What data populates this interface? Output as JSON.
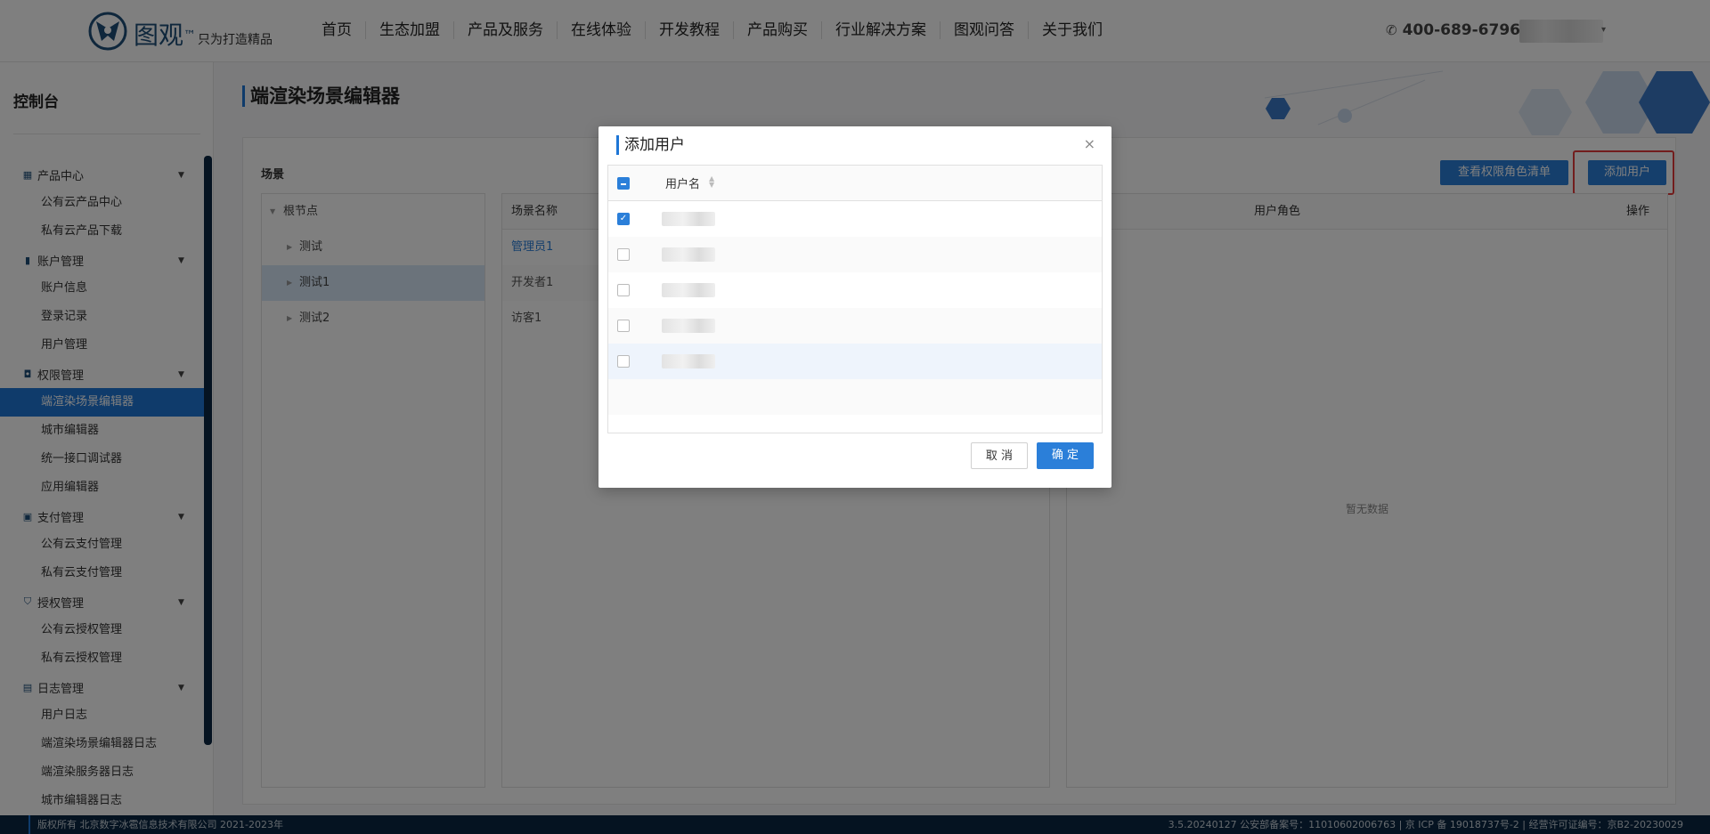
{
  "header": {
    "logo_name": "图观",
    "logo_tm": "™",
    "logo_slogan": "只为打造精品",
    "nav": [
      "首页",
      "生态加盟",
      "产品及服务",
      "在线体验",
      "开发教程",
      "产品购买",
      "行业解决方案",
      "图观问答",
      "关于我们"
    ],
    "phone": "400-689-6796",
    "phone_icon": "phone-icon",
    "user_caret": "▾"
  },
  "sidebar": {
    "title": "控制台",
    "groups": [
      {
        "label": "产品中心",
        "icon": "grid-icon",
        "items": [
          "公有云产品中心",
          "私有云产品下载"
        ]
      },
      {
        "label": "账户管理",
        "icon": "bookmark-icon",
        "items": [
          "账户信息",
          "登录记录",
          "用户管理"
        ]
      },
      {
        "label": "权限管理",
        "icon": "lock-icon",
        "items": [
          "端渲染场景编辑器",
          "城市编辑器",
          "统一接口调试器",
          "应用编辑器"
        ]
      },
      {
        "label": "支付管理",
        "icon": "ticket-icon",
        "items": [
          "公有云支付管理",
          "私有云支付管理"
        ]
      },
      {
        "label": "授权管理",
        "icon": "shield-icon",
        "items": [
          "公有云授权管理",
          "私有云授权管理"
        ]
      },
      {
        "label": "日志管理",
        "icon": "log-icon",
        "items": [
          "用户日志",
          "端渲染场景编辑器日志",
          "端渲染服务器日志",
          "城市编辑器日志"
        ]
      }
    ],
    "active_item": "端渲染场景编辑器"
  },
  "main": {
    "title": "端渲染场景编辑器",
    "scene_label": "场景",
    "btn_roles": "查看权限角色清单",
    "btn_add_user": "添加用户",
    "tree": {
      "root": "根节点",
      "children": [
        "测试",
        "测试1",
        "测试2"
      ],
      "selected": "测试1"
    },
    "scene_table": {
      "header": "场景名称",
      "rows": [
        "管理员1",
        "开发者1",
        "访客1"
      ]
    },
    "user_table": {
      "col_role": "用户角色",
      "col_action": "操作",
      "empty": "暂无数据"
    }
  },
  "modal": {
    "title": "添加用户",
    "close": "×",
    "col_username": "用户名",
    "rows": [
      {
        "checked": true
      },
      {
        "checked": false
      },
      {
        "checked": false
      },
      {
        "checked": false
      },
      {
        "checked": false
      }
    ],
    "cancel": "取 消",
    "ok": "确 定"
  },
  "footer": {
    "left": "版权所有 北京数字冰雹信息技术有限公司 2021-2023年",
    "right": "3.5.20240127 公安部备案号：11010602006763 | 京 ICP 备 19018737号-2 | 经营许可证编号：京B2-20230029"
  },
  "colors": {
    "accent": "#2b7fd9",
    "sidebar_active": "#1e76d6",
    "footer_bg": "#0b2742",
    "highlight": "#e53b3b"
  }
}
